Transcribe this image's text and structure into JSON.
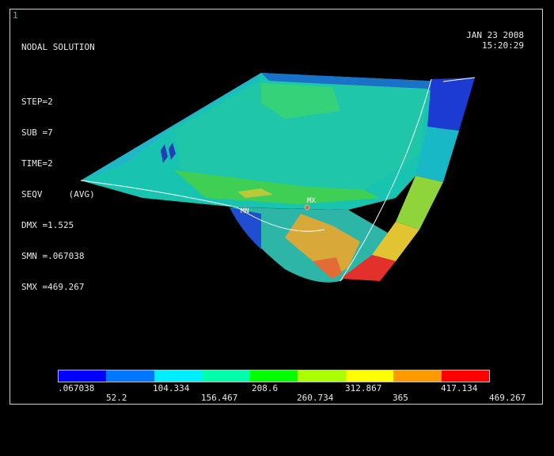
{
  "window": {
    "number": "1"
  },
  "header": {
    "title": "NODAL SOLUTION",
    "step": "STEP=2",
    "sub": "SUB =7",
    "time": "TIME=2",
    "seqv": "SEQV     (AVG)",
    "dmx": "DMX =1.525",
    "smn": "SMN =.067038",
    "smx": "SMX =469.267"
  },
  "timestamp": {
    "date": "JAN 23 2008",
    "time": "15:20:29"
  },
  "markers": {
    "min": "MN",
    "max": "MX"
  },
  "legend": {
    "colors": [
      "#0000ff",
      "#0077ff",
      "#00eeff",
      "#00ffaa",
      "#00ff00",
      "#aaff00",
      "#ffff00",
      "#ff9900",
      "#ff0000"
    ],
    "top_labels": [
      ".067038",
      "104.334",
      "208.6",
      "312.867",
      "417.134"
    ],
    "bottom_labels": [
      "52.2",
      "156.467",
      "260.734",
      "365",
      "469.267"
    ]
  }
}
